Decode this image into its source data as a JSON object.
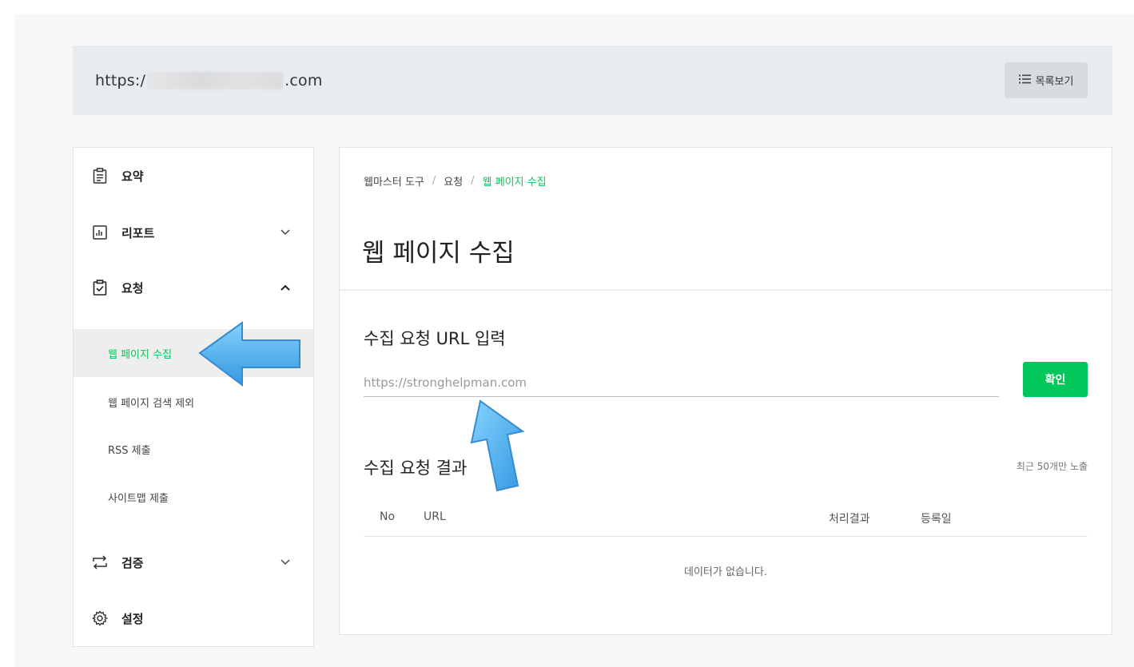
{
  "header": {
    "url_prefix": "https:/",
    "url_suffix": ".com",
    "list_view_label": "목록보기",
    "list_view_icon": "list-icon"
  },
  "sidebar": {
    "items": [
      {
        "label": "요약",
        "icon": "summary-clipboard-icon",
        "expandable": false
      },
      {
        "label": "리포트",
        "icon": "report-chart-icon",
        "expandable": true,
        "expanded": false
      },
      {
        "label": "요청",
        "icon": "request-check-icon",
        "expandable": true,
        "expanded": true
      },
      {
        "label": "검증",
        "icon": "verify-arrows-icon",
        "expandable": true,
        "expanded": false
      },
      {
        "label": "설정",
        "icon": "settings-gear-icon",
        "expandable": false
      }
    ],
    "sub_items": [
      {
        "label": "웹 페이지 수집",
        "active": true
      },
      {
        "label": "웹 페이지 검색 제외",
        "active": false
      },
      {
        "label": "RSS 제출",
        "active": false
      },
      {
        "label": "사이트맵 제출",
        "active": false
      }
    ]
  },
  "main": {
    "breadcrumb": [
      "웹마스터 도구",
      "요청",
      "웹 페이지 수집"
    ],
    "breadcrumb_sep": "/",
    "title": "웹 페이지 수집",
    "url_section_title": "수집 요청 URL 입력",
    "url_input_placeholder": "https://stronghelpman.com",
    "confirm_label": "확인",
    "result_section_title": "수집 요청 결과",
    "recent_note": "최근 50개만 노출",
    "table_columns": [
      "No",
      "URL",
      "처리결과",
      "등록일"
    ],
    "empty_message": "데이터가 없습니다."
  },
  "colors": {
    "accent": "#03c75a",
    "arrow": "#3aa8ec"
  }
}
